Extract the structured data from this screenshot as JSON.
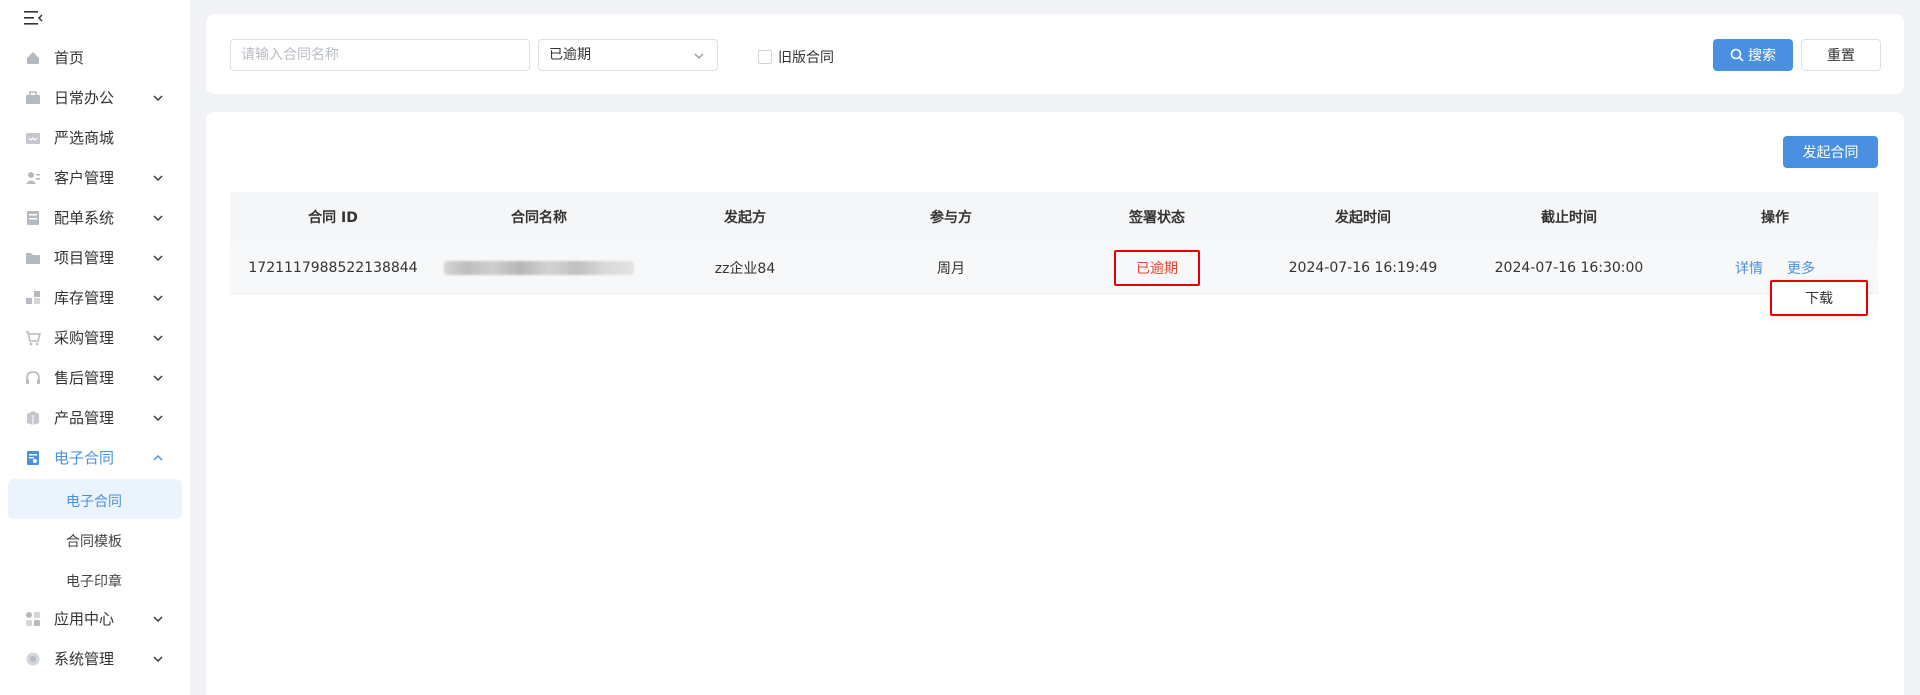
{
  "sidebar": {
    "items": [
      {
        "label": "首页",
        "icon": "home-icon",
        "has_children": false
      },
      {
        "label": "日常办公",
        "icon": "briefcase-icon",
        "has_children": true
      },
      {
        "label": "严选商城",
        "icon": "store-icon",
        "has_children": false
      },
      {
        "label": "客户管理",
        "icon": "customer-icon",
        "has_children": true
      },
      {
        "label": "配单系统",
        "icon": "order-icon",
        "has_children": true
      },
      {
        "label": "项目管理",
        "icon": "folder-icon",
        "has_children": true
      },
      {
        "label": "库存管理",
        "icon": "inventory-icon",
        "has_children": true
      },
      {
        "label": "采购管理",
        "icon": "cart-icon",
        "has_children": true
      },
      {
        "label": "售后管理",
        "icon": "headset-icon",
        "has_children": true
      },
      {
        "label": "产品管理",
        "icon": "box-icon",
        "has_children": true
      },
      {
        "label": "电子合同",
        "icon": "contract-icon",
        "has_children": true,
        "expanded": true,
        "active": true
      },
      {
        "label": "应用中心",
        "icon": "apps-icon",
        "has_children": true
      },
      {
        "label": "系统管理",
        "icon": "settings-icon",
        "has_children": true
      }
    ],
    "sub_items": [
      {
        "label": "电子合同",
        "active": true
      },
      {
        "label": "合同模板"
      },
      {
        "label": "电子印章"
      }
    ]
  },
  "filter": {
    "name_placeholder": "请输入合同名称",
    "status_value": "已逾期",
    "old_version_label": "旧版合同",
    "search_label": "搜索",
    "reset_label": "重置"
  },
  "main": {
    "initiate_label": "发起合同",
    "columns": [
      "合同 ID",
      "合同名称",
      "发起方",
      "参与方",
      "签署状态",
      "发起时间",
      "截止时间",
      "操作"
    ],
    "rows": [
      {
        "id": "1721117988522138844",
        "initiator": "zz企业84",
        "participant": "周月",
        "status": "已逾期",
        "start_time": "2024-07-16 16:19:49",
        "end_time": "2024-07-16 16:30:00",
        "detail_label": "详情",
        "more_label": "更多"
      }
    ],
    "dropdown_items": [
      "下载"
    ]
  },
  "colors": {
    "accent": "#4a90e2",
    "overdue": "#e9442f",
    "highlight_border": "#e60000"
  }
}
